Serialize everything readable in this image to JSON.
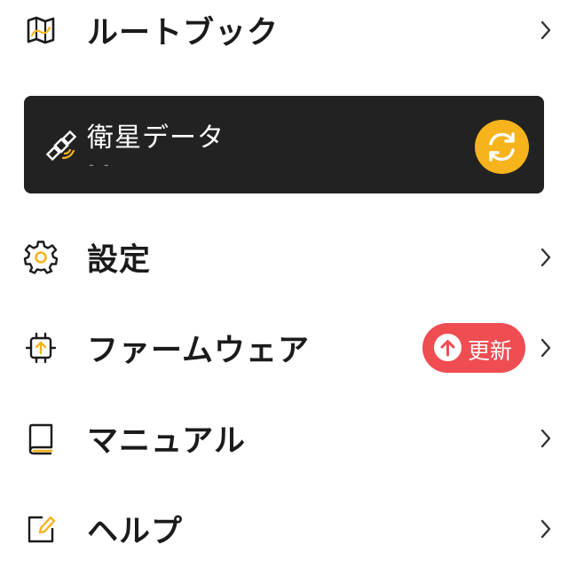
{
  "colors": {
    "accent": "#f6b31c",
    "card_background": "#222222",
    "badge_background": "#ef4d52",
    "text": "#1b1b1b"
  },
  "menu": {
    "route_book": {
      "label": "ルートブック",
      "icon": "map-icon"
    },
    "satellite": {
      "title": "衛星データ",
      "status": "- -",
      "icon": "satellite-icon",
      "action_icon": "sync-icon"
    },
    "settings": {
      "label": "設定",
      "icon": "gear-icon"
    },
    "firmware": {
      "label": "ファームウェア",
      "icon": "chip-icon",
      "badge_label": "更新",
      "badge_icon": "arrow-up-icon"
    },
    "manual": {
      "label": "マニュアル",
      "icon": "book-icon"
    },
    "help": {
      "label": "ヘルプ",
      "icon": "edit-icon"
    }
  }
}
